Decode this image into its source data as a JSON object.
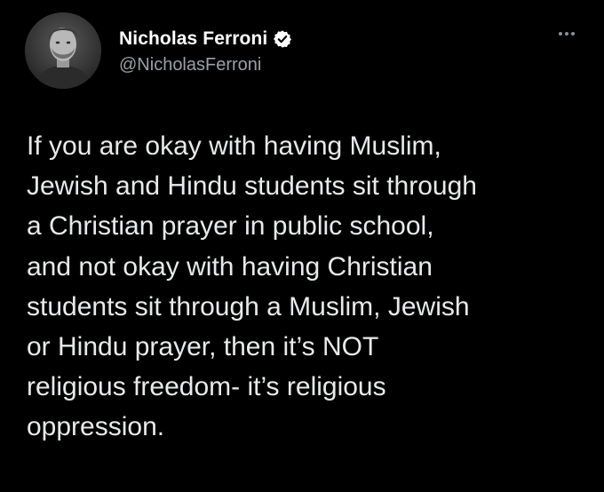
{
  "author": {
    "display_name": "Nicholas Ferroni",
    "handle": "@NicholasFerroni",
    "verified": true
  },
  "tweet": {
    "lines": [
      "If you are okay with having Muslim,",
      "Jewish and Hindu students sit through",
      "a Christian prayer in public school,",
      "and not okay with having Christian",
      "students sit through a Muslim, Jewish",
      "or Hindu prayer, then it’s NOT",
      "religious freedom- it’s religious",
      "oppression."
    ]
  },
  "icons": {
    "avatar": "avatar-photo",
    "verified": "verified-badge-icon",
    "more": "more-options-icon"
  },
  "colors": {
    "background": "#000000",
    "text": "#e7e9ea",
    "name": "#ffffff",
    "handle": "#9aa0a6"
  }
}
